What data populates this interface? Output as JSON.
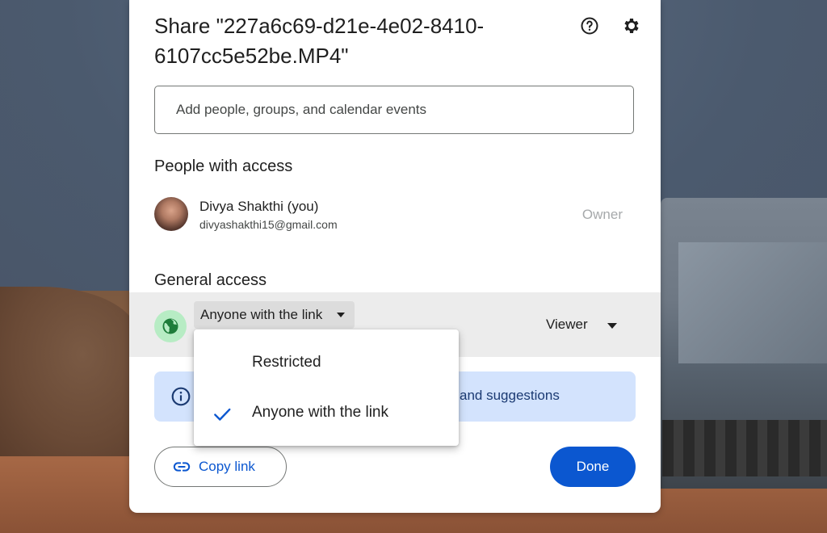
{
  "dialog": {
    "title": "Share \"227a6c69-d21e-4e02-8410-6107cc5e52be.MP4\"",
    "help_icon": "help-circle-icon",
    "settings_icon": "gear-icon"
  },
  "add_people": {
    "placeholder": "Add people, groups, and calendar events",
    "value": ""
  },
  "people_with_access": {
    "heading": "People with access",
    "people": [
      {
        "name": "Divya Shakthi (you)",
        "email": "divyashakthi15@gmail.com",
        "role": "Owner"
      }
    ]
  },
  "general_access": {
    "heading": "General access",
    "selected": "Anyone with the link",
    "role": "Viewer",
    "globe_icon": "globe-icon",
    "globe_color": "#1e7c3a",
    "globe_bg": "#b7ecc4"
  },
  "access_menu": {
    "options": [
      {
        "label": "Restricted",
        "checked": false
      },
      {
        "label": "Anyone with the link",
        "checked": true
      }
    ],
    "check_color": "#0b57d0"
  },
  "info_banner": {
    "text": "and suggestions",
    "icon": "info-icon"
  },
  "actions": {
    "copy_link_label": "Copy link",
    "done_label": "Done",
    "accent": "#0b57d0"
  }
}
